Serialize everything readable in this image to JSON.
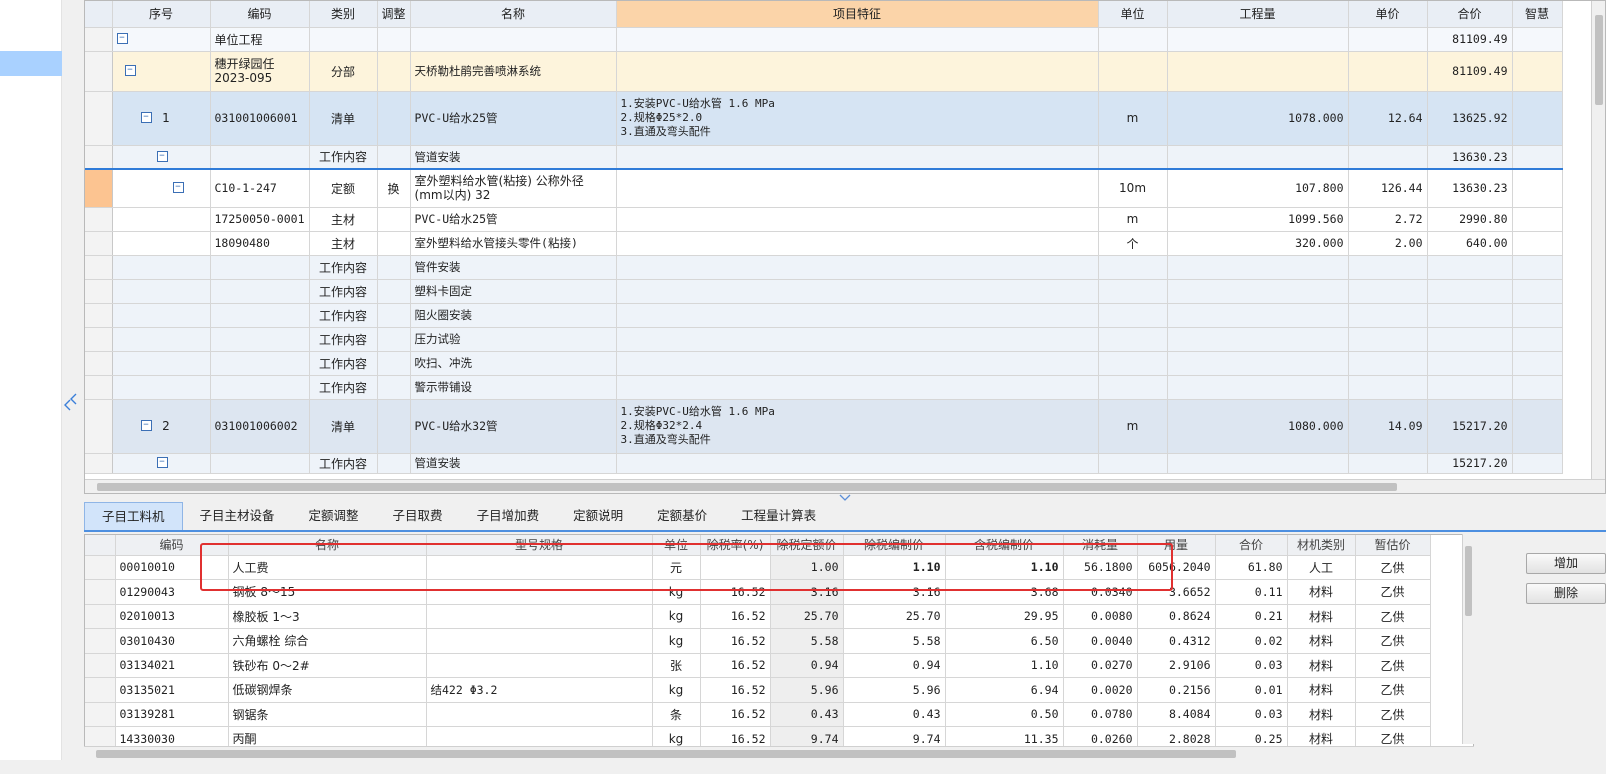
{
  "upper": {
    "headers": [
      "序号",
      "编码",
      "类别",
      "调整",
      "名称",
      "项目特征",
      "单位",
      "工程量",
      "单价",
      "合价",
      "智慧"
    ],
    "rows": [
      {
        "seq": "",
        "code": "单位工程",
        "type": "",
        "adj": "",
        "name": "",
        "feature": "",
        "unit": "",
        "qty": "",
        "price": "",
        "total": "81109.49",
        "toggle": "−",
        "kind": "unit"
      },
      {
        "seq": "",
        "code": "穗开绿园任2023-095",
        "type": "分部",
        "adj": "",
        "name": "天桥勒杜鹃完善喷淋系统",
        "feature": "",
        "unit": "",
        "qty": "",
        "price": "",
        "total": "81109.49",
        "toggle": "−",
        "kind": "fenbu"
      },
      {
        "seq": "1",
        "code": "031001006001",
        "type": "清单",
        "adj": "",
        "name": "PVC-U给水25管",
        "feature": "1.安装PVC-U给水管 1.6 MPa\n2.规格Φ25*2.0\n3.直通及弯头配件",
        "unit": "m",
        "qty": "1078.000",
        "price": "12.64",
        "total": "13625.92",
        "toggle": "−",
        "kind": "qd"
      },
      {
        "seq": "",
        "code": "",
        "type": "工作内容",
        "adj": "",
        "name": "管道安装",
        "feature": "",
        "unit": "",
        "qty": "",
        "price": "",
        "total": "13630.23",
        "toggle": "−",
        "kind": "work"
      },
      {
        "seq": "",
        "code": "C10-1-247",
        "type": "定额",
        "adj": "换",
        "name": "室外塑料给水管(粘接) 公称外径(mm以内) 32",
        "feature": "",
        "unit": "10m",
        "qty": "107.800",
        "price": "126.44",
        "total": "13630.23",
        "toggle": "−",
        "kind": "de"
      },
      {
        "seq": "",
        "code": "17250050-0001",
        "type": "主材",
        "adj": "",
        "name": "PVC-U给水25管",
        "feature": "",
        "unit": "m",
        "qty": "1099.560",
        "price": "2.72",
        "total": "2990.80",
        "toggle": "",
        "kind": "white"
      },
      {
        "seq": "",
        "code": "18090480",
        "type": "主材",
        "adj": "",
        "name": "室外塑料给水管接头零件(粘接)",
        "feature": "",
        "unit": "个",
        "qty": "320.000",
        "price": "2.00",
        "total": "640.00",
        "toggle": "",
        "kind": "white"
      },
      {
        "seq": "",
        "code": "",
        "type": "工作内容",
        "adj": "",
        "name": "管件安装",
        "feature": "",
        "unit": "",
        "qty": "",
        "price": "",
        "total": "",
        "toggle": "",
        "kind": "work"
      },
      {
        "seq": "",
        "code": "",
        "type": "工作内容",
        "adj": "",
        "name": "塑料卡固定",
        "feature": "",
        "unit": "",
        "qty": "",
        "price": "",
        "total": "",
        "toggle": "",
        "kind": "work"
      },
      {
        "seq": "",
        "code": "",
        "type": "工作内容",
        "adj": "",
        "name": "阻火圈安装",
        "feature": "",
        "unit": "",
        "qty": "",
        "price": "",
        "total": "",
        "toggle": "",
        "kind": "work"
      },
      {
        "seq": "",
        "code": "",
        "type": "工作内容",
        "adj": "",
        "name": "压力试验",
        "feature": "",
        "unit": "",
        "qty": "",
        "price": "",
        "total": "",
        "toggle": "",
        "kind": "work"
      },
      {
        "seq": "",
        "code": "",
        "type": "工作内容",
        "adj": "",
        "name": "吹扫、冲洗",
        "feature": "",
        "unit": "",
        "qty": "",
        "price": "",
        "total": "",
        "toggle": "",
        "kind": "work"
      },
      {
        "seq": "",
        "code": "",
        "type": "工作内容",
        "adj": "",
        "name": "警示带铺设",
        "feature": "",
        "unit": "",
        "qty": "",
        "price": "",
        "total": "",
        "toggle": "",
        "kind": "work"
      },
      {
        "seq": "2",
        "code": "031001006002",
        "type": "清单",
        "adj": "",
        "name": "PVC-U给水32管",
        "feature": "1.安装PVC-U给水管 1.6 MPa\n2.规格Φ32*2.4\n3.直通及弯头配件",
        "unit": "m",
        "qty": "1080.000",
        "price": "14.09",
        "total": "15217.20",
        "toggle": "−",
        "kind": "qd2"
      },
      {
        "seq": "",
        "code": "",
        "type": "工作内容",
        "adj": "",
        "name": "管道安装",
        "feature": "",
        "unit": "",
        "qty": "",
        "price": "",
        "total": "15217.20",
        "toggle": "−",
        "kind": "work"
      }
    ]
  },
  "tabs": [
    "子目工料机",
    "子目主材设备",
    "定额调整",
    "子目取费",
    "子目增加费",
    "定额说明",
    "定额基价",
    "工程量计算表"
  ],
  "lower": {
    "headers": [
      "编码",
      "名称",
      "型号规格",
      "单位",
      "除税率(%)",
      "除税定额价",
      "除税编制价",
      "含税编制价",
      "消耗量",
      "用量",
      "合价",
      "材机类别",
      "暂估价"
    ],
    "rows": [
      {
        "code": "00010010",
        "name": "人工费",
        "spec": "",
        "unit": "元",
        "rate": "",
        "base": "1.00",
        "tax_ex": "1.10",
        "tax_in": "1.10",
        "cons": "56.1800",
        "usage": "6056.2040",
        "total": "61.80",
        "cat": "人工",
        "est": "乙供"
      },
      {
        "code": "01290043",
        "name": "钢板 8～15",
        "spec": "",
        "unit": "kg",
        "rate": "16.52",
        "base": "3.16",
        "tax_ex": "3.16",
        "tax_in": "3.68",
        "cons": "0.0340",
        "usage": "3.6652",
        "total": "0.11",
        "cat": "材料",
        "est": "乙供"
      },
      {
        "code": "02010013",
        "name": "橡胶板 1～3",
        "spec": "",
        "unit": "kg",
        "rate": "16.52",
        "base": "25.70",
        "tax_ex": "25.70",
        "tax_in": "29.95",
        "cons": "0.0080",
        "usage": "0.8624",
        "total": "0.21",
        "cat": "材料",
        "est": "乙供"
      },
      {
        "code": "03010430",
        "name": "六角螺栓 综合",
        "spec": "",
        "unit": "kg",
        "rate": "16.52",
        "base": "5.58",
        "tax_ex": "5.58",
        "tax_in": "6.50",
        "cons": "0.0040",
        "usage": "0.4312",
        "total": "0.02",
        "cat": "材料",
        "est": "乙供"
      },
      {
        "code": "03134021",
        "name": "铁砂布 0～2#",
        "spec": "",
        "unit": "张",
        "rate": "16.52",
        "base": "0.94",
        "tax_ex": "0.94",
        "tax_in": "1.10",
        "cons": "0.0270",
        "usage": "2.9106",
        "total": "0.03",
        "cat": "材料",
        "est": "乙供"
      },
      {
        "code": "03135021",
        "name": "低碳钢焊条",
        "spec": "结422 Φ3.2",
        "unit": "kg",
        "rate": "16.52",
        "base": "5.96",
        "tax_ex": "5.96",
        "tax_in": "6.94",
        "cons": "0.0020",
        "usage": "0.2156",
        "total": "0.01",
        "cat": "材料",
        "est": "乙供"
      },
      {
        "code": "03139281",
        "name": "钢锯条",
        "spec": "",
        "unit": "条",
        "rate": "16.52",
        "base": "0.43",
        "tax_ex": "0.43",
        "tax_in": "0.50",
        "cons": "0.0780",
        "usage": "8.4084",
        "total": "0.03",
        "cat": "材料",
        "est": "乙供"
      },
      {
        "code": "14330030",
        "name": "丙酮",
        "spec": "",
        "unit": "kg",
        "rate": "16.52",
        "base": "9.74",
        "tax_ex": "9.74",
        "tax_in": "11.35",
        "cons": "0.0260",
        "usage": "2.8028",
        "total": "0.25",
        "cat": "材料",
        "est": "乙供"
      }
    ]
  },
  "buttons": {
    "add": "增加",
    "delete": "删除"
  },
  "icons": {
    "collapse": "double-chevron-icon",
    "splitter": "triangle-down-icon",
    "toggle": "minus-box-icon"
  },
  "colors": {
    "accent": "#4d8fe0",
    "selected_row_marker": "#fcc491",
    "header_highlight": "#fbd4a9",
    "annotation": "#e03030"
  }
}
